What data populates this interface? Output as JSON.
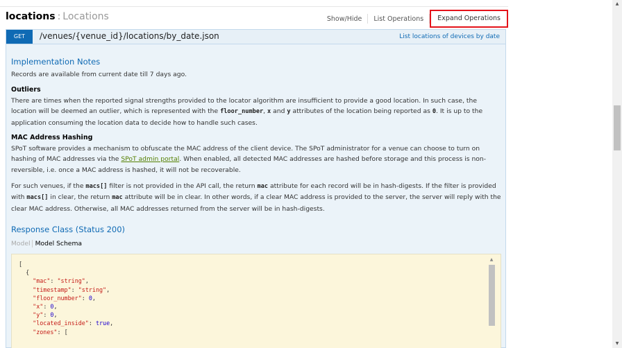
{
  "resource": {
    "name": "locations",
    "separator": ":",
    "description": "Locations",
    "ops": {
      "show_hide": "Show/Hide",
      "list_operations": "List Operations",
      "expand_operations": "Expand Operations"
    }
  },
  "endpoint": {
    "method": "GET",
    "path": "/venues/{venue_id}/locations/by_date.json",
    "summary": "List locations of devices by date"
  },
  "implementation": {
    "title": "Implementation Notes",
    "text": "Records are available from current date till 7 days ago.",
    "outliers": {
      "title": "Outliers",
      "p1": "There are times when the reported signal strengths provided to the locator algorithm are insufficient to provide a good location. In such case, the location will be deemed an outlier, which is represented with the",
      "code1": "floor_number",
      "p2": ",",
      "code2": "x",
      "p3": "and",
      "code3": "y",
      "p4": "attributes of the location being reported as",
      "code4": "0",
      "p5": ". It is up to the application consuming the location data to decide how to handle such cases."
    },
    "mac": {
      "title": "MAC Address Hashing",
      "p1": "SPoT software provides a mechanism to obfuscate the MAC address of the client device. The SPoT administrator for a venue can choose to turn on hashing of MAC addresses via the",
      "link": "SPoT admin portal",
      "p2": ". When enabled, all detected MAC addresses are hashed before storage and this process is non-reversible, i.e. once a MAC address is hashed, it will not be recoverable.",
      "q1": "For such venues, if the",
      "code1": "macs[]",
      "q2": "filter is not provided in the API call, the return",
      "code2": "mac",
      "q3": "attribute for each record will be in hash-digests. If the filter is provided with",
      "code3": "macs[]",
      "q4": "in clear, the return",
      "code4": "mac",
      "q5": "attribute will be in clear. In other words, if a clear MAC address is provided to the server, the server will reply with the clear MAC address. Otherwise, all MAC addresses returned from the server will be in hash-digests."
    }
  },
  "response": {
    "title": "Response Class (Status 200)",
    "tab_model": "Model",
    "tab_schema": "Model Schema",
    "schema_lines": {
      "l1": "[",
      "l2": "  {",
      "mac_key": "\"mac\"",
      "mac_val": "\"string\"",
      "ts_key": "\"timestamp\"",
      "ts_val": "\"string\"",
      "floor_key": "\"floor_number\"",
      "floor_val": "0",
      "x_key": "\"x\"",
      "x_val": "0",
      "y_key": "\"y\"",
      "y_val": "0",
      "inside_key": "\"located_inside\"",
      "inside_val": "true",
      "zones_key": "\"zones\"",
      "zones_val": "["
    }
  },
  "colors": {
    "accent_blue": "#0f6ab4",
    "link_green": "#547f00",
    "highlight_red": "#e4121a",
    "schema_bg": "#fcf6db"
  }
}
